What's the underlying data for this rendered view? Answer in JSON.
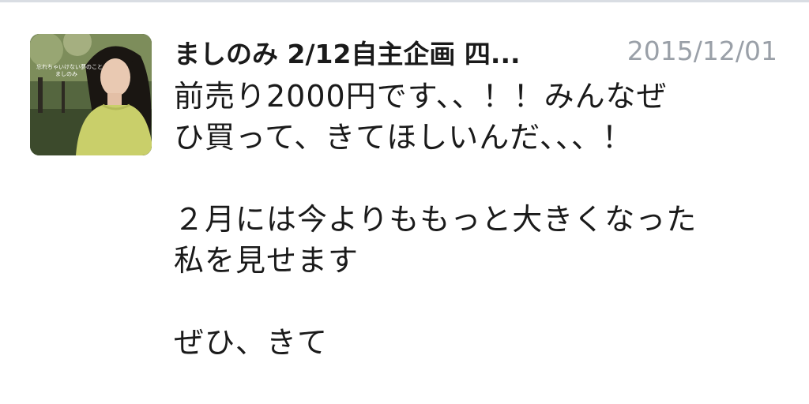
{
  "tweet": {
    "author_name": "ましのみ 2/12自主企画 四...",
    "timestamp": "2015/12/01",
    "avatar_caption_line1": "忘れちゃいけない夢のこと",
    "avatar_caption_line2": "ましのみ",
    "lines": [
      "前売り2000円です、、！！みんなぜ",
      "ひ買って、きてほしいんだ、、、！",
      "",
      "２月には今よりももっと大きくなった",
      "私を見せます",
      "",
      "ぜひ、きて"
    ]
  },
  "colors": {
    "text": "#1a1a1a",
    "timestamp": "#9aa0a8",
    "divider": "#d9dde3"
  }
}
